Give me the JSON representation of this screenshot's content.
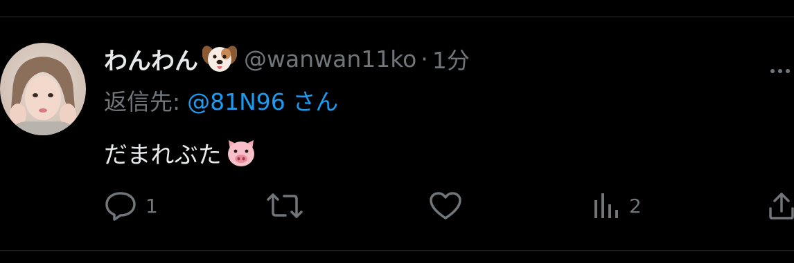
{
  "tweet": {
    "author": {
      "display_name": "わんわん",
      "name_emoji": "dog-face",
      "handle": "@wanwan11ko",
      "separator": "·",
      "time": "1分"
    },
    "reply_to": {
      "prefix": "返信先:",
      "target": "@81N96 さん"
    },
    "text": "だまれぶた",
    "text_emoji": "pig-face",
    "actions": {
      "reply_count": "1",
      "retweet_count": "",
      "like_count": "",
      "views_count": "2"
    }
  },
  "colors": {
    "background": "#000000",
    "primary_text": "#e7e9ea",
    "secondary_text": "#71767b",
    "link": "#1d9bf0",
    "divider": "#2f3336"
  }
}
